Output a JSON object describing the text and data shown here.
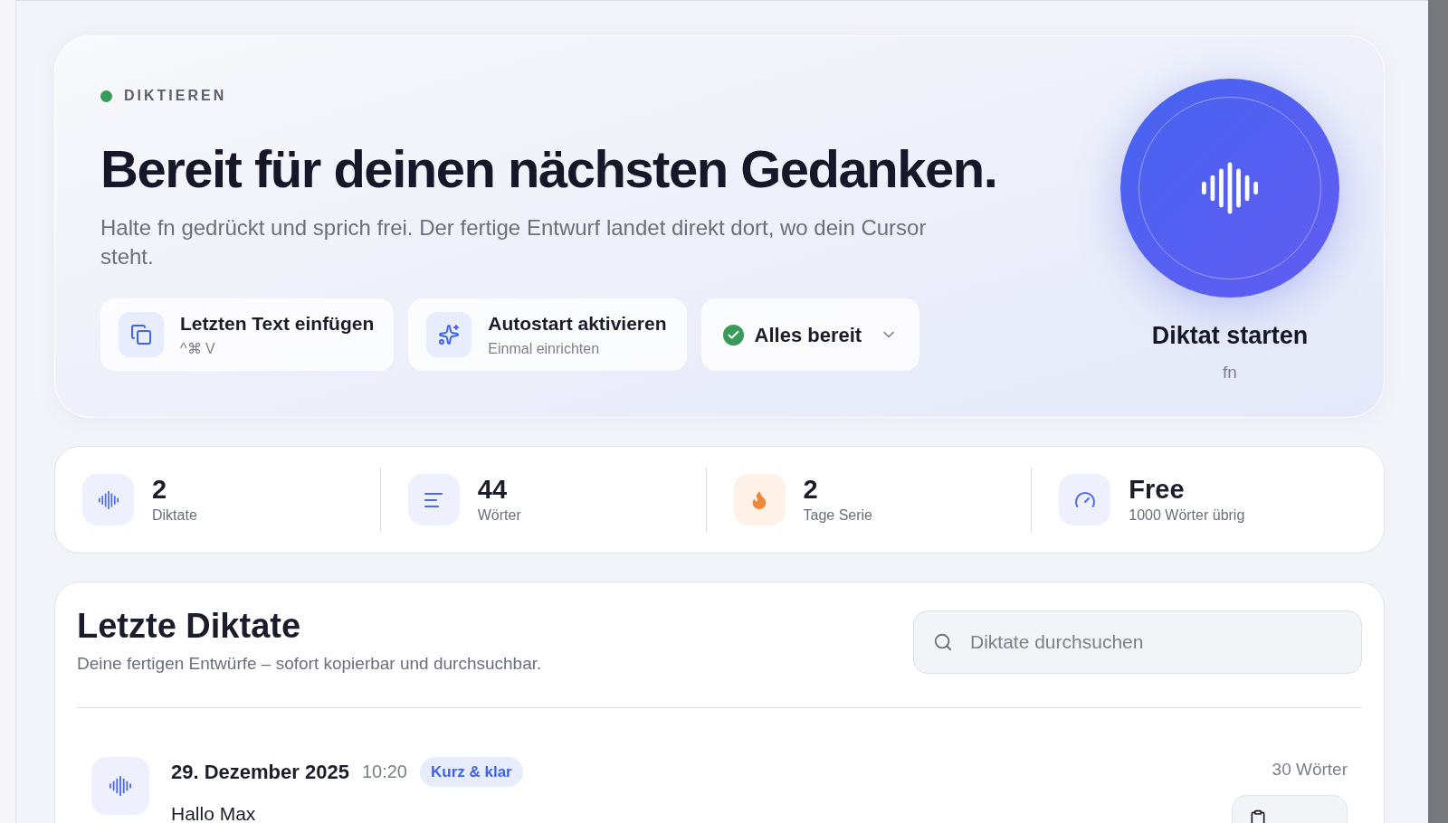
{
  "hero": {
    "status": {
      "label": "DIKTIEREN",
      "color": "#3a9a5b"
    },
    "title": "Bereit für deinen nächsten Gedanken.",
    "subtitle": "Halte fn gedrückt und sprich frei. Der fertige Entwurf landet direkt dort, wo dein Cursor steht.",
    "actions": [
      {
        "kind": "paste",
        "title": "Letzten Text einfügen",
        "subtitle": "^⌘ V"
      },
      {
        "kind": "autostart",
        "title": "Autostart aktivieren",
        "subtitle": "Einmal einrichten"
      },
      {
        "kind": "status",
        "title": "Alles bereit"
      }
    ],
    "record": {
      "label": "Diktat starten",
      "shortcut": "fn"
    }
  },
  "stats": [
    {
      "kind": "dictations",
      "value": "2",
      "label": "Diktate"
    },
    {
      "kind": "words",
      "value": "44",
      "label": "Wörter"
    },
    {
      "kind": "streak",
      "value": "2",
      "label": "Tage Serie"
    },
    {
      "kind": "plan",
      "value": "Free",
      "label": "1000 Wörter übrig"
    }
  ],
  "recent": {
    "title": "Letzte Diktate",
    "subtitle": "Deine fertigen Entwürfe – sofort kopierbar und durchsuchbar.",
    "search": {
      "placeholder": "Diktate durchsuchen"
    },
    "items": [
      {
        "date": "29. Dezember 2025",
        "time": "10:20",
        "tag": "Kurz & klar",
        "text": "Hallo Max",
        "words": "30 Wörter"
      }
    ]
  }
}
